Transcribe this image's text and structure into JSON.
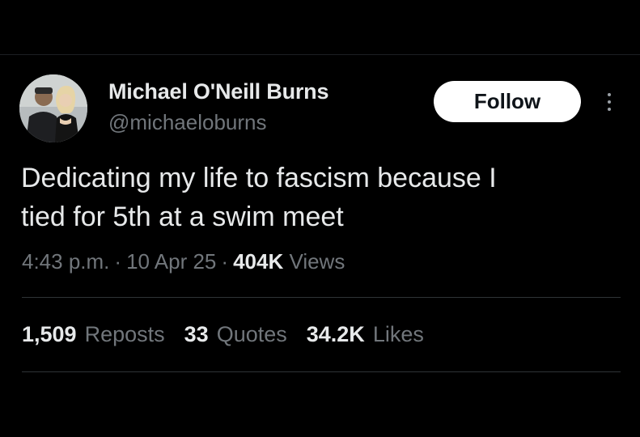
{
  "author": {
    "display_name": "Michael O'Neill Burns",
    "handle": "@michaeloburns",
    "avatar_icon": "profile-photo-two-people"
  },
  "actions": {
    "follow_label": "Follow",
    "more_icon": "more-vertical-icon"
  },
  "tweet": {
    "text": "Dedicating my life to fascism because I\ntied for 5th at a swim meet"
  },
  "meta": {
    "time": "4:43 p.m.",
    "separator": "·",
    "date": "10 Apr 25",
    "views_count": "404K",
    "views_label": "Views"
  },
  "stats": {
    "reposts_count": "1,509",
    "reposts_label": "Reposts",
    "quotes_count": "33",
    "quotes_label": "Quotes",
    "likes_count": "34.2K",
    "likes_label": "Likes"
  },
  "colors": {
    "background": "#000000",
    "primary_text": "#e7e9ea",
    "secondary_text": "#71767b",
    "divider": "#2f3336",
    "follow_bg": "#ffffff"
  }
}
